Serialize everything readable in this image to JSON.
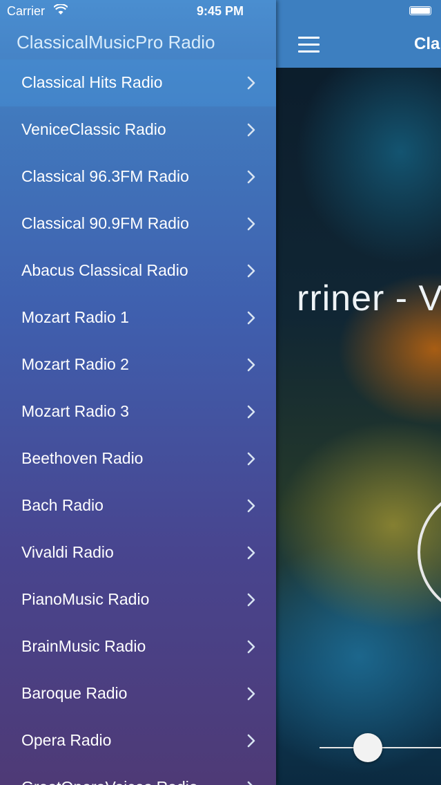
{
  "status_bar": {
    "carrier": "Carrier",
    "time": "9:45 PM"
  },
  "drawer": {
    "title": "ClassicalMusicPro Radio",
    "items": [
      {
        "label": "Classical Hits Radio",
        "selected": true
      },
      {
        "label": "VeniceClassic Radio"
      },
      {
        "label": "Classical 96.3FM Radio"
      },
      {
        "label": "Classical 90.9FM Radio"
      },
      {
        "label": "Abacus Classical Radio"
      },
      {
        "label": "Mozart Radio 1"
      },
      {
        "label": "Mozart Radio 2"
      },
      {
        "label": "Mozart Radio 3"
      },
      {
        "label": "Beethoven Radio"
      },
      {
        "label": "Bach Radio"
      },
      {
        "label": "Vivaldi Radio"
      },
      {
        "label": "PianoMusic Radio"
      },
      {
        "label": "BrainMusic Radio"
      },
      {
        "label": "Baroque Radio"
      },
      {
        "label": "Opera Radio"
      },
      {
        "label": "GreatOperaVoices Radio"
      }
    ],
    "chevron_icon": "chevron-right-icon"
  },
  "main": {
    "nav_title": "Cla",
    "menu_icon": "hamburger-icon",
    "now_playing": "rriner - V",
    "volume_level": 0.35,
    "colors": {
      "nav": "#3d7fc0",
      "drawer_top": "#4a8ed0",
      "drawer_bottom": "#4e3a76"
    }
  }
}
